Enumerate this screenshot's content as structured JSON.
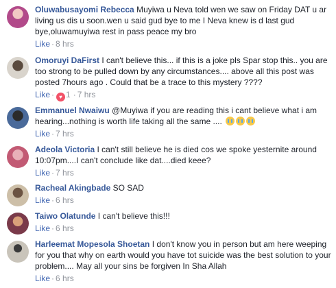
{
  "comments": [
    {
      "name": "Oluwabusayomi Rebecca",
      "text": "Muyiwa u Neva told wen we saw on Friday DAT u ar living us dis u soon.wen u said gud bye to me I Neva knew is d last gud bye,oluwamuyiwa rest in pass peace my bro",
      "like": "Like",
      "time": "8 hrs",
      "avatar_color": "#b24a8a"
    },
    {
      "name": "Omoruyi DaFirst",
      "text": "I can't believe this... if this is a joke pls Spar stop this.. you are too strong to be pulled down by any circumstances.... above all this post was posted 7hours ago . Could that be a trace to this mystery ????",
      "like": "Like",
      "reactions": "1",
      "time": "7 hrs",
      "avatar_color": "#7b6b5c"
    },
    {
      "name": "Emmanuel Nwaiwu",
      "text": "@Muyiwa if you are reading this i cant believe what i am hearing...nothing is worth life taking all the same ....",
      "emoji_count": 3,
      "like": "Like",
      "time": "7 hrs",
      "avatar_color": "#3d4a63"
    },
    {
      "name": "Adeola Victoria",
      "text": "I can't still believe he is died cos we spoke yesternite around 10:07pm....I can't conclude like dat....died keee?",
      "like": "Like",
      "time": "7 hrs",
      "avatar_color": "#c25a74"
    },
    {
      "name": "Racheal Akingbade",
      "text": "SO SAD",
      "like": "Like",
      "time": "6 hrs",
      "avatar_color": "#8a6f55"
    },
    {
      "name": "Taiwo Olatunde",
      "text": "I can't believe this!!!",
      "like": "Like",
      "time": "6 hrs",
      "avatar_color": "#7a3a4a"
    },
    {
      "name": "Harleemat Mopesola Shoetan",
      "text": "I don't know you in person but am here weeping for you that why on earth would you have tot suicide was the best solution to your problem.... May all your sins be forgiven In Sha Allah",
      "like": "Like",
      "time": "6 hrs",
      "avatar_color": "#9e9a92"
    }
  ]
}
